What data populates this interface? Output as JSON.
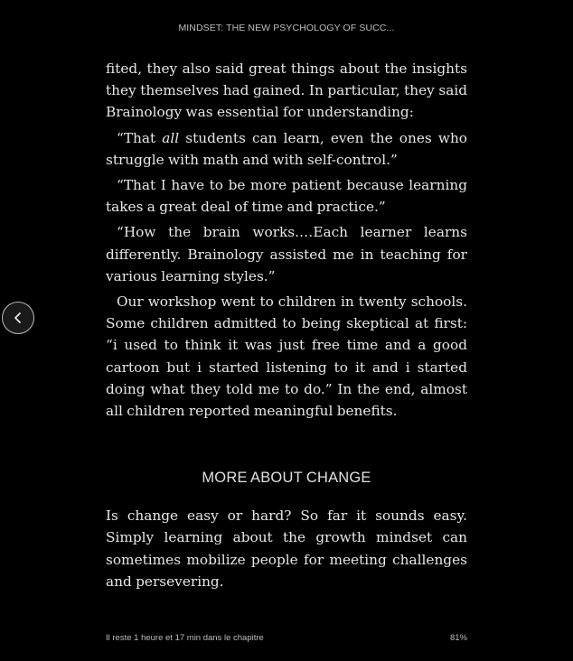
{
  "header": {
    "book_title": "MINDSET: THE NEW PSYCHOLOGY OF SUCC..."
  },
  "content": {
    "p1": "fited, they also said great things about the insights they themselves had gained. In particular, they said Brainology was essential for understanding:",
    "p2_before": "“That ",
    "p2_emph": "all",
    "p2_after": " students can learn, even the ones who struggle with math and with self-control.”",
    "p3": "“That I have to be more patient because learning takes a great deal of time and practice.”",
    "p4": "“How the brain works.…Each learner learns differ­ently. Brainology assisted me in teaching for various learning styles.”",
    "p5": "Our workshop went to children in twenty schools. Some children admitted to being skeptical at first: “i used to think it was just free time and a good cartoon but i started listening to it and i started doing what they told me to do.” In the end, almost all children re­ported meaningful benefits.",
    "section_heading": "MORE ABOUT CHANGE",
    "p6": "Is change easy or hard? So far it sounds easy. Simply learning about the growth mindset can sometimes mobilize people for meeting challenges and perse­vering."
  },
  "navigation": {
    "back_icon": "chevron-left-icon"
  },
  "footer": {
    "time_left": "Il reste 1 heure et 17 min dans le chapitre",
    "progress": "81%"
  },
  "colors": {
    "background": "#000000",
    "text": "#e8e8e8",
    "secondary_text": "#bdbdbd"
  }
}
